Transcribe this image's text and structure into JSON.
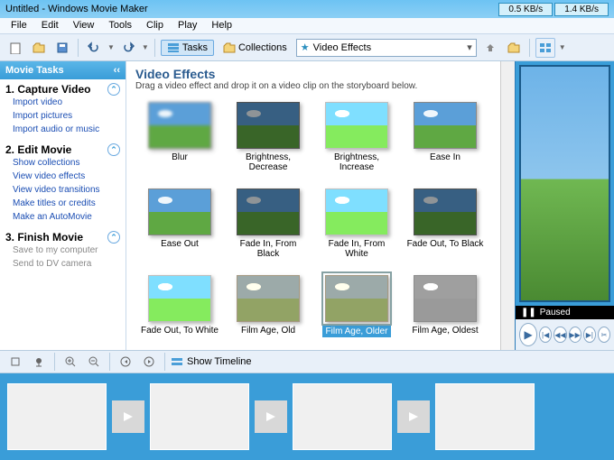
{
  "title": "Untitled - Windows Movie Maker",
  "speed": {
    "down": "0.5 KB/s",
    "up": "1.4 KB/s"
  },
  "menu": [
    "File",
    "Edit",
    "View",
    "Tools",
    "Clip",
    "Play",
    "Help"
  ],
  "toolbar": {
    "tasks_label": "Tasks",
    "collections_label": "Collections",
    "dropdown": "Video Effects"
  },
  "sidebar": {
    "header": "Movie Tasks",
    "sections": [
      {
        "title": "1. Capture Video",
        "links": [
          "Import video",
          "Import pictures",
          "Import audio or music"
        ]
      },
      {
        "title": "2. Edit Movie",
        "links": [
          "Show collections",
          "View video effects",
          "View video transitions",
          "Make titles or credits",
          "Make an AutoMovie"
        ]
      },
      {
        "title": "3. Finish Movie",
        "links": [
          "Save to my computer",
          "Send to DV camera"
        ],
        "gray": true
      }
    ]
  },
  "effects": {
    "title": "Video Effects",
    "subtitle": "Drag a video effect and drop it on a video clip on the storyboard below.",
    "items": [
      {
        "name": "Blur",
        "cls": "blur"
      },
      {
        "name": "Brightness, Decrease",
        "cls": "dark"
      },
      {
        "name": "Brightness, Increase",
        "cls": "bright"
      },
      {
        "name": "Ease In",
        "cls": ""
      },
      {
        "name": "Ease Out",
        "cls": ""
      },
      {
        "name": "Fade In, From Black",
        "cls": "dark"
      },
      {
        "name": "Fade In, From White",
        "cls": "bright"
      },
      {
        "name": "Fade Out, To Black",
        "cls": "dark"
      },
      {
        "name": "Fade Out, To White",
        "cls": "bright"
      },
      {
        "name": "Film Age, Old",
        "cls": "old"
      },
      {
        "name": "Film Age, Older",
        "cls": "old",
        "selected": true
      },
      {
        "name": "Film Age, Oldest",
        "cls": "oldest"
      }
    ]
  },
  "preview": {
    "status": "Paused"
  },
  "timeline": {
    "show": "Show Timeline"
  }
}
